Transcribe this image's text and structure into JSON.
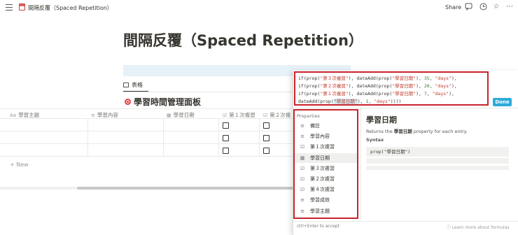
{
  "topbar": {
    "breadcrumb": "間隔反覆（Spaced Repetition）",
    "share": "Share"
  },
  "page": {
    "title": "間隔反覆（Spaced Repetition）",
    "tab_label": "表格",
    "db_title": "學習時間管理面板"
  },
  "table": {
    "columns": [
      "學習主題",
      "學習內容",
      "學習日期",
      "第１次複習",
      "第２次複"
    ],
    "new_label": "+ New"
  },
  "formula": {
    "lines": [
      [
        "if(prop(",
        "\"第３次複習\"",
        "), dateAdd(prop(",
        "\"學習日期\"",
        "), ",
        "35",
        ", ",
        "\"days\"",
        "),"
      ],
      [
        "if(prop(",
        "\"第２次複習\"",
        "), dateAdd(prop(",
        "\"學習日期\"",
        "), ",
        "20",
        ", ",
        "\"days\"",
        "),"
      ],
      [
        "if(prop(",
        "\"第１次複習\"",
        "), dateAdd(prop(",
        "\"學習日期\"",
        "), ",
        "7",
        ", ",
        "\"days\"",
        "),"
      ],
      [
        "dateAdd(prop(",
        "\"學習日期\"",
        "), ",
        "1",
        ", ",
        "\"days\"",
        "))))"
      ]
    ],
    "done_label": "Done",
    "properties_label": "Properties",
    "properties": [
      {
        "label": "備註",
        "icon": "text-icon"
      },
      {
        "label": "學習內容",
        "icon": "text-icon"
      },
      {
        "label": "第１次複習",
        "icon": "checkbox-icon"
      },
      {
        "label": "學習日期",
        "icon": "calendar-icon"
      },
      {
        "label": "第３次複習",
        "icon": "checkbox-icon"
      },
      {
        "label": "第２次複習",
        "icon": "checkbox-icon"
      },
      {
        "label": "第４次複習",
        "icon": "checkbox-icon"
      },
      {
        "label": "學習成效",
        "icon": "text-icon"
      },
      {
        "label": "學習主題",
        "icon": "text-icon"
      }
    ],
    "selected_index": 3,
    "info_title": "學習日期",
    "info_desc_prefix": "Returns the ",
    "info_desc_bold": "學習日期",
    "info_desc_suffix": " property for each entry.",
    "syntax_label": "Syntax",
    "syntax_code": "prop(\"學習日期\")",
    "footer_hint": "ctrl+Enter to accept",
    "learn_more": "Learn more about formulas"
  },
  "colors": {
    "highlight_border": "#c8232c",
    "done_button": "#2eaadc"
  }
}
